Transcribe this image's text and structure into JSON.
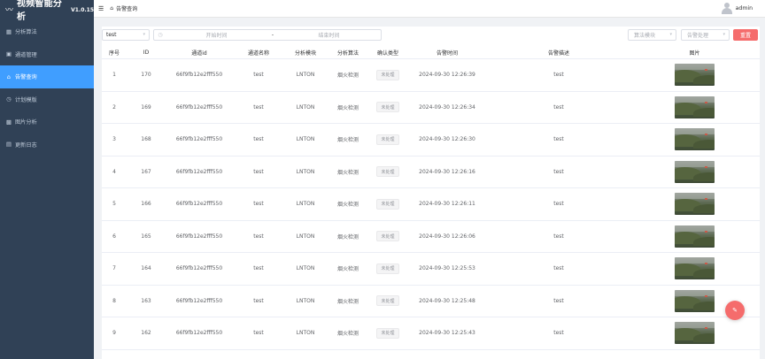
{
  "app": {
    "title": "视频智能分析",
    "version": "V1.0.15",
    "logo_icon": "pulse-icon"
  },
  "sidebar": {
    "items": [
      {
        "label": "分析算法",
        "icon": "grid-icon",
        "glyph": "▦",
        "active": false
      },
      {
        "label": "通道管理",
        "icon": "video-camera-icon",
        "glyph": "▣",
        "active": false
      },
      {
        "label": "告警查询",
        "icon": "bell-icon",
        "glyph": "⌂",
        "active": true
      },
      {
        "label": "计划模版",
        "icon": "clock-icon",
        "glyph": "◷",
        "active": false
      },
      {
        "label": "图片分析",
        "icon": "image-icon",
        "glyph": "▩",
        "active": false
      },
      {
        "label": "更新日志",
        "icon": "document-icon",
        "glyph": "▤",
        "active": false
      }
    ]
  },
  "header": {
    "menu_icon": "hamburger-icon",
    "breadcrumb": "告警查询",
    "username": "admin"
  },
  "filters": {
    "channel_value": "test",
    "start_placeholder": "开始时间",
    "separator": "-",
    "end_placeholder": "结束时间",
    "algo_placeholder": "算法模块",
    "status_placeholder": "告警处理",
    "reset_label": "重置"
  },
  "table": {
    "columns": [
      "序号",
      "ID",
      "通道id",
      "通道名称",
      "分析模块",
      "分析算法",
      "确认类型",
      "告警时间",
      "告警描述",
      "图片"
    ],
    "rows": [
      {
        "index": "1",
        "id": "170",
        "channel_id": "66f9fb12e2fff550",
        "channel_name": "test",
        "module": "LNTON",
        "algorithm": "烟火检测",
        "confirm": "未处理",
        "time": "2024-09-30 12:26:39",
        "desc": "test"
      },
      {
        "index": "2",
        "id": "169",
        "channel_id": "66f9fb12e2fff550",
        "channel_name": "test",
        "module": "LNTON",
        "algorithm": "烟火检测",
        "confirm": "未处理",
        "time": "2024-09-30 12:26:34",
        "desc": "test"
      },
      {
        "index": "3",
        "id": "168",
        "channel_id": "66f9fb12e2fff550",
        "channel_name": "test",
        "module": "LNTON",
        "algorithm": "烟火检测",
        "confirm": "未处理",
        "time": "2024-09-30 12:26:30",
        "desc": "test"
      },
      {
        "index": "4",
        "id": "167",
        "channel_id": "66f9fb12e2fff550",
        "channel_name": "test",
        "module": "LNTON",
        "algorithm": "烟火检测",
        "confirm": "未处理",
        "time": "2024-09-30 12:26:16",
        "desc": "test"
      },
      {
        "index": "5",
        "id": "166",
        "channel_id": "66f9fb12e2fff550",
        "channel_name": "test",
        "module": "LNTON",
        "algorithm": "烟火检测",
        "confirm": "未处理",
        "time": "2024-09-30 12:26:11",
        "desc": "test"
      },
      {
        "index": "6",
        "id": "165",
        "channel_id": "66f9fb12e2fff550",
        "channel_name": "test",
        "module": "LNTON",
        "algorithm": "烟火检测",
        "confirm": "未处理",
        "time": "2024-09-30 12:26:06",
        "desc": "test"
      },
      {
        "index": "7",
        "id": "164",
        "channel_id": "66f9fb12e2fff550",
        "channel_name": "test",
        "module": "LNTON",
        "algorithm": "烟火检测",
        "confirm": "未处理",
        "time": "2024-09-30 12:25:53",
        "desc": "test"
      },
      {
        "index": "8",
        "id": "163",
        "channel_id": "66f9fb12e2fff550",
        "channel_name": "test",
        "module": "LNTON",
        "algorithm": "烟火检测",
        "confirm": "未处理",
        "time": "2024-09-30 12:25:48",
        "desc": "test"
      },
      {
        "index": "9",
        "id": "162",
        "channel_id": "66f9fb12e2fff550",
        "channel_name": "test",
        "module": "LNTON",
        "algorithm": "烟火检测",
        "confirm": "未处理",
        "time": "2024-09-30 12:25:43",
        "desc": "test"
      }
    ]
  },
  "fab": {
    "icon": "pen-icon",
    "glyph": "✎"
  },
  "colors": {
    "sidebar_bg": "#304156",
    "accent": "#409eff",
    "danger": "#f56c6c"
  }
}
